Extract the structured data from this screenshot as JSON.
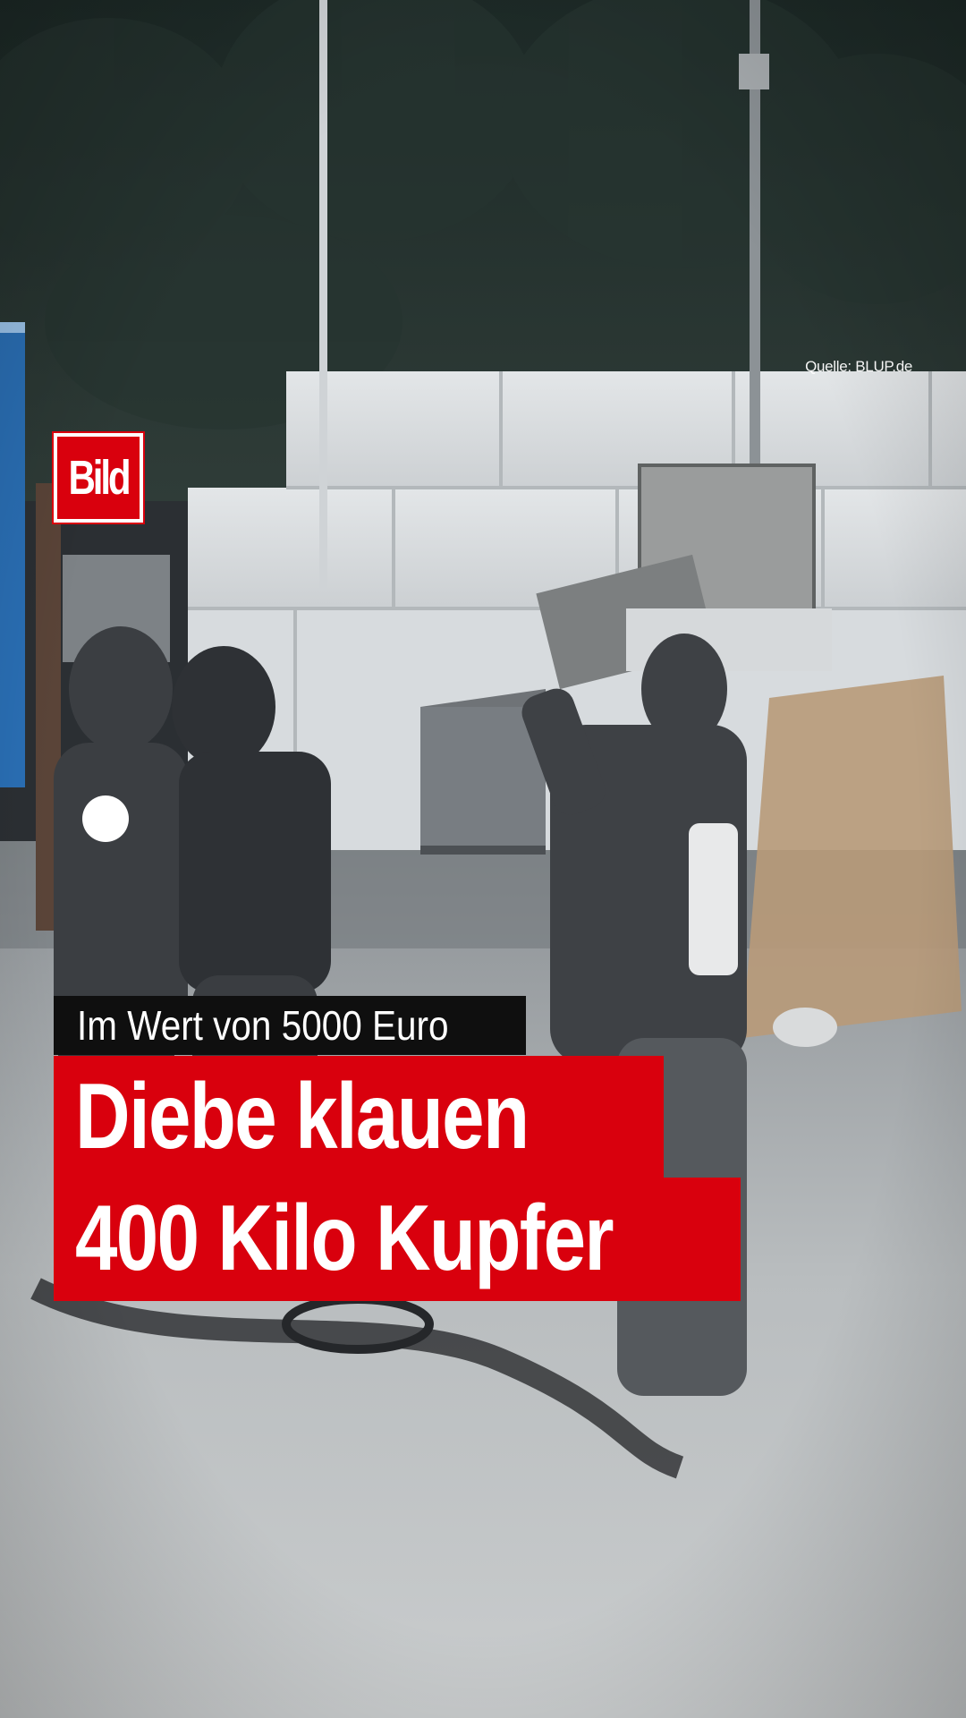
{
  "brand": {
    "logo_text": "Bild",
    "accent_color": "#d9000d"
  },
  "source_credit": "Quelle: BLUP.de",
  "overlay": {
    "kicker": "Im Wert von 5000 Euro",
    "headline_line_1": "Diebe klauen",
    "headline_line_2": "400 Kilo Kupfer"
  }
}
